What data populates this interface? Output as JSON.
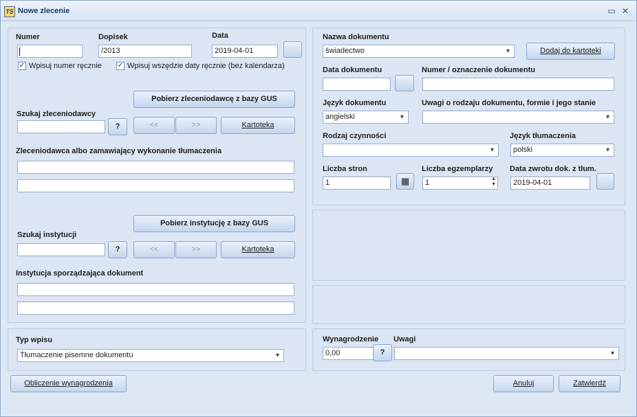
{
  "window": {
    "title": "Nowe zlecenie",
    "icon_text": "TS"
  },
  "left": {
    "numer_label": "Numer",
    "numer_value": "",
    "dopisek_label": "Dopisek",
    "dopisek_value": "/2013",
    "data_label": "Data",
    "data_value": "2019-04-01",
    "chk_numer_label": "Wpisuj numer ręcznie",
    "chk_daty_label": "Wpisuj wszędzie daty ręcznie (bez kalendarza)",
    "gus_client_btn": "Pobierz zleceniodawcę z bazy GUS",
    "szukaj_zlec_label": "Szukaj zleceniodawcy",
    "help_btn": "?",
    "prev_btn": "<<",
    "next_btn": ">>",
    "kartoteka_btn": "Kartoteka",
    "zlec_label": "Zleceniodawca albo zamawiający wykonanie tłumaczenia",
    "gus_inst_btn": "Pobierz instytucję z bazy GUS",
    "szukaj_inst_label": "Szukaj instytucji",
    "inst_label": "Instytucja sporządzająca dokument"
  },
  "typ": {
    "label": "Typ wpisu",
    "value": "Tłumaczenie pisemne dokumentu"
  },
  "right": {
    "nazwa_label": "Nazwa dokumentu",
    "nazwa_value": "świadectwo",
    "dodaj_btn": "Dodaj do kartoteki",
    "data_dok_label": "Data dokumentu",
    "data_dok_value": "",
    "numer_dok_label": "Numer / oznaczenie dokumentu",
    "jezyk_dok_label": "Język dokumentu",
    "jezyk_dok_value": "angielski",
    "uwagi_rodzaj_label": "Uwagi o rodzaju dokumentu, formie i jego stanie",
    "rodzaj_label": "Rodzaj czynności",
    "jezyk_tl_label": "Język tłumaczenia",
    "jezyk_tl_value": "polski",
    "liczba_stron_label": "Liczba stron",
    "liczba_stron_value": "1",
    "liczba_egz_label": "Liczba egzemplarzy",
    "liczba_egz_value": "1",
    "data_zwrotu_label": "Data zwrotu dok. z tłum.",
    "data_zwrotu_value": "2019-04-01"
  },
  "pay": {
    "wyn_label": "Wynagrodzenie",
    "wyn_value": "0,00",
    "uwagi_label": "Uwagi",
    "help_btn": "?"
  },
  "footer": {
    "oblicz_btn": "Obliczenie wynagrodzenia",
    "anuluj_btn": "Anuluj",
    "zatwierdz_btn": "Zatwierdź"
  }
}
